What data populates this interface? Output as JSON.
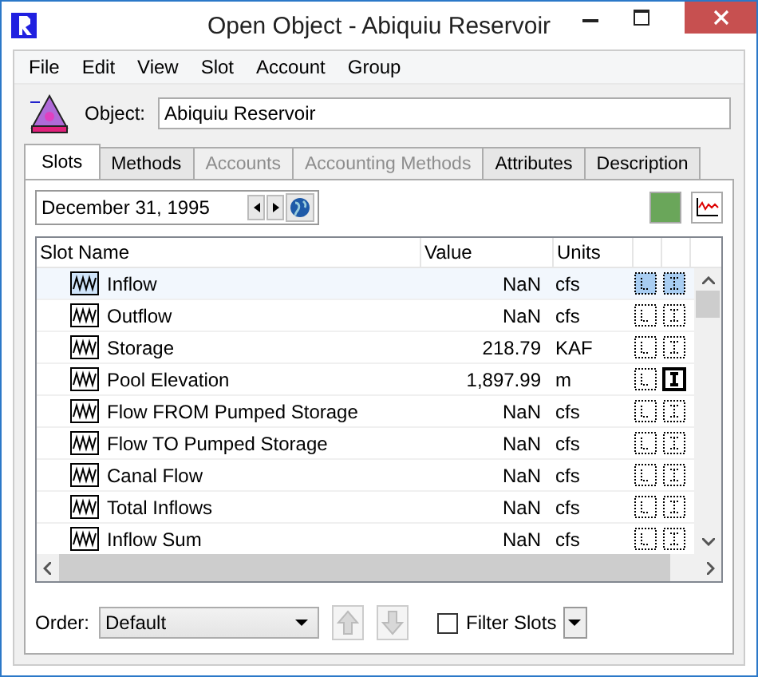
{
  "window": {
    "title": "Open Object - Abiquiu Reservoir"
  },
  "menu": [
    "File",
    "Edit",
    "View",
    "Slot",
    "Account",
    "Group"
  ],
  "object": {
    "label": "Object:",
    "value": "Abiquiu Reservoir"
  },
  "tabs": [
    {
      "label": "Slots",
      "selected": true,
      "disabled": false
    },
    {
      "label": "Methods",
      "selected": false,
      "disabled": false
    },
    {
      "label": "Accounts",
      "selected": false,
      "disabled": true
    },
    {
      "label": "Accounting Methods",
      "selected": false,
      "disabled": true
    },
    {
      "label": "Attributes",
      "selected": false,
      "disabled": false
    },
    {
      "label": "Description",
      "selected": false,
      "disabled": false
    }
  ],
  "date": "December 31, 1995",
  "table": {
    "columns": [
      "Slot Name",
      "Value",
      "Units"
    ],
    "rows": [
      {
        "name": "Inflow",
        "value": "NaN",
        "units": "cfs",
        "selected": true,
        "input": false
      },
      {
        "name": "Outflow",
        "value": "NaN",
        "units": "cfs",
        "selected": false,
        "input": false
      },
      {
        "name": "Storage",
        "value": "218.79",
        "units": "KAF",
        "selected": false,
        "input": false
      },
      {
        "name": "Pool Elevation",
        "value": "1,897.99",
        "units": "m",
        "selected": false,
        "input": true
      },
      {
        "name": "Flow FROM Pumped Storage",
        "value": "NaN",
        "units": "cfs",
        "selected": false,
        "input": false
      },
      {
        "name": "Flow TO Pumped Storage",
        "value": "NaN",
        "units": "cfs",
        "selected": false,
        "input": false
      },
      {
        "name": "Canal Flow",
        "value": "NaN",
        "units": "cfs",
        "selected": false,
        "input": false
      },
      {
        "name": "Total Inflows",
        "value": "NaN",
        "units": "cfs",
        "selected": false,
        "input": false
      },
      {
        "name": "Inflow Sum",
        "value": "NaN",
        "units": "cfs",
        "selected": false,
        "input": false
      }
    ]
  },
  "order": {
    "label": "Order:",
    "value": "Default"
  },
  "filter": {
    "label": "Filter Slots",
    "checked": false
  }
}
